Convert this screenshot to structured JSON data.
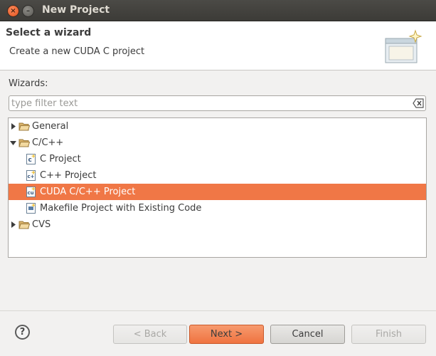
{
  "window": {
    "title": "New Project"
  },
  "header": {
    "title": "Select a wizard",
    "subtitle": "Create a new CUDA C project"
  },
  "wizards_label": "Wizards:",
  "filter": {
    "value": "",
    "placeholder": "type filter text"
  },
  "tree": {
    "items": [
      {
        "label": "General",
        "type": "folder",
        "expanded": false,
        "selected": false
      },
      {
        "label": "C/C++",
        "type": "folder",
        "expanded": true,
        "selected": false
      },
      {
        "label": "C Project",
        "type": "project",
        "selected": false
      },
      {
        "label": "C++ Project",
        "type": "project",
        "selected": false
      },
      {
        "label": "CUDA C/C++ Project",
        "type": "project",
        "selected": true
      },
      {
        "label": "Makefile Project with Existing Code",
        "type": "project",
        "selected": false
      },
      {
        "label": "CVS",
        "type": "folder",
        "expanded": false,
        "selected": false
      }
    ]
  },
  "buttons": {
    "back": "< Back",
    "next": "Next >",
    "cancel": "Cancel",
    "finish": "Finish"
  },
  "colors": {
    "selection": "#f07746",
    "primary_button": "#ef7340",
    "titlebar": "#3c3b37"
  }
}
